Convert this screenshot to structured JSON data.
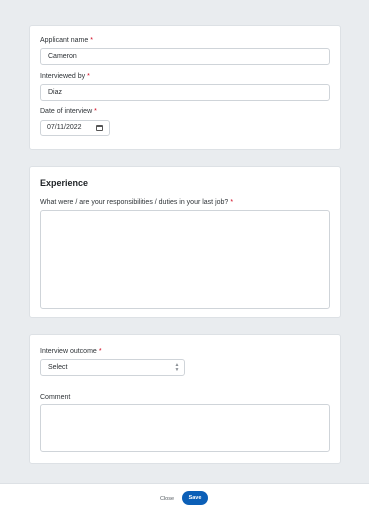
{
  "applicant": {
    "name_label": "Applicant name",
    "name_value": "Cameron",
    "interviewer_label": "Interviewed by",
    "interviewer_value": "Diaz",
    "date_label": "Date of interview",
    "date_value": "07/11/2022",
    "required_mark": "*"
  },
  "experience": {
    "title": "Experience",
    "question_label": "What were / are your responsibilities / duties in your last job?",
    "answer_value": ""
  },
  "outcome": {
    "outcome_label": "Interview outcome",
    "outcome_selected": "Select",
    "comment_label": "Comment",
    "comment_value": ""
  },
  "footer": {
    "close_label": "Close",
    "save_label": "Save"
  },
  "icons": {
    "date": "calendar-icon",
    "select": "select-arrows-icon"
  },
  "colors": {
    "background": "#e9ecef",
    "card": "#ffffff",
    "required": "#d0021b",
    "primary": "#0b5fb7"
  }
}
